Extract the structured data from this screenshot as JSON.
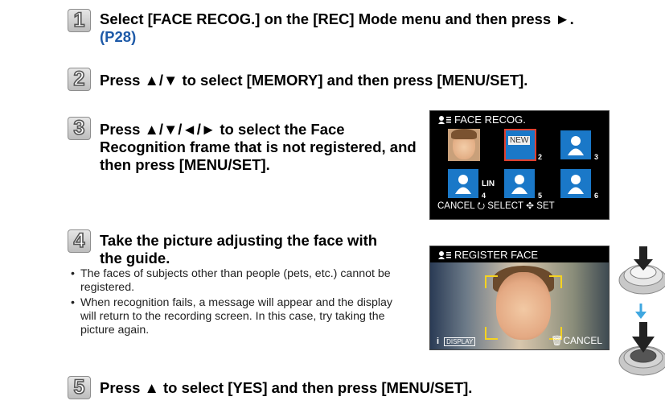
{
  "steps": [
    {
      "num": "1",
      "text": "Select [FACE RECOG.] on the [REC] Mode menu and then press ►.",
      "ref": "(P28)"
    },
    {
      "num": "2",
      "text": "Press ▲/▼ to select [MEMORY] and then press [MENU/SET]."
    },
    {
      "num": "3",
      "text": "Press ▲/▼/◄/► to select the Face Recognition frame that is not registered, and then press [MENU/SET]."
    },
    {
      "num": "4",
      "text": "Take the picture adjusting the face with the guide."
    },
    {
      "num": "5",
      "text": "Press ▲ to select [YES] and then press [MENU/SET]."
    }
  ],
  "notes": [
    "The faces of subjects other than people (pets, etc.) cannot be registered.",
    "When recognition fails, a message will appear and the display will return to the recording screen. In this case, try taking the picture again."
  ],
  "screen1": {
    "title": "FACE RECOG.",
    "new_tag": "NEW",
    "name_label": "LIN",
    "slot_numbers": [
      "2",
      "3",
      "4",
      "5",
      "6"
    ],
    "footer": "CANCEL ⭮ SELECT ✥  SET"
  },
  "screen2": {
    "title": "REGISTER FACE",
    "info_icon": "i",
    "display_label": "DISPLAY",
    "cancel": "CANCEL"
  },
  "colors": {
    "accent_blue": "#1e5aa8",
    "lcd_slot_blue": "#1a78c8",
    "guide_yellow": "#f6d31f"
  }
}
